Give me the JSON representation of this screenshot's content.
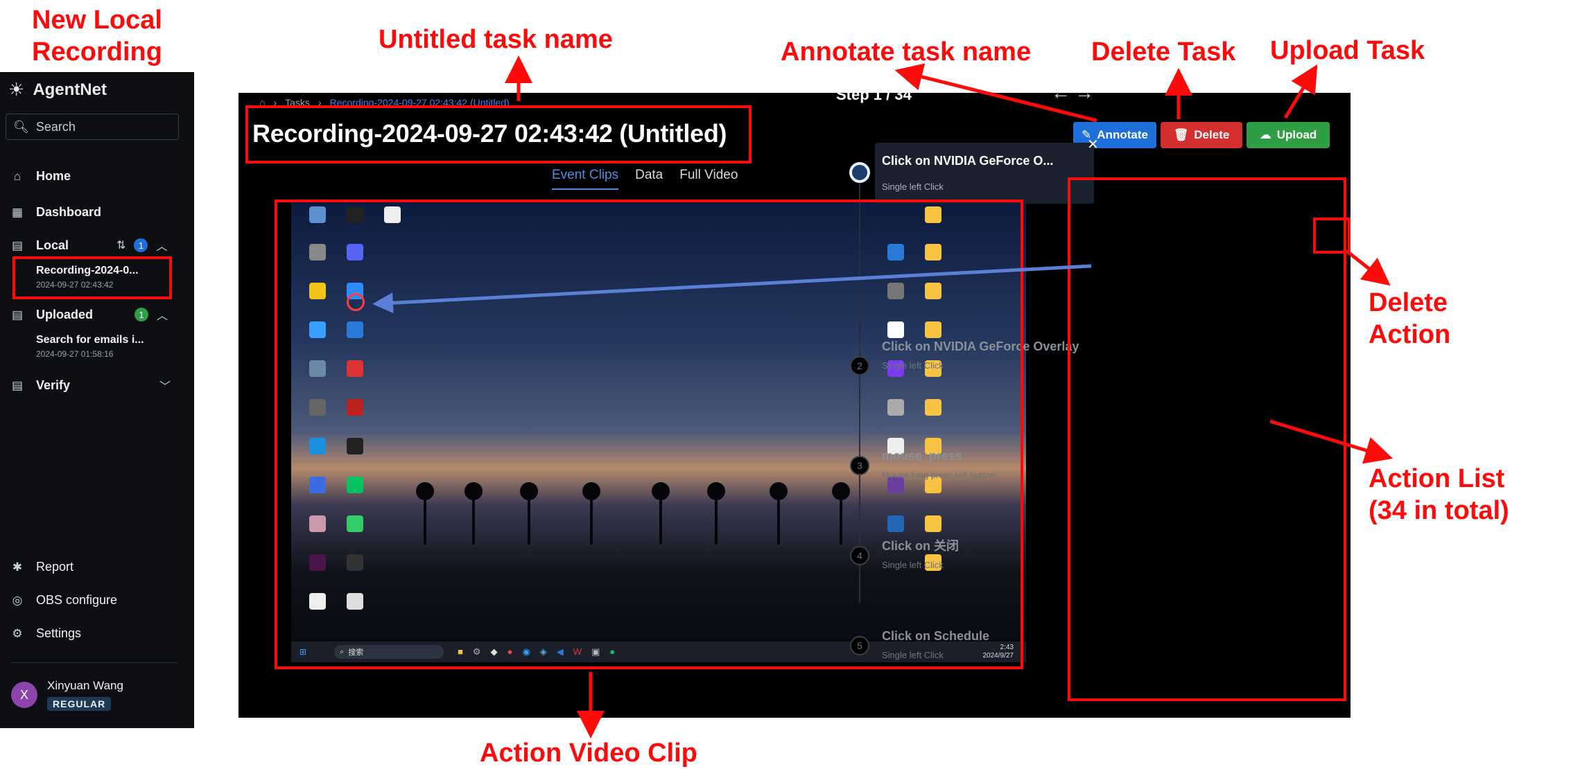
{
  "annotations": {
    "new_local_recording": "New Local\nRecording",
    "untitled_task_name": "Untitled task name",
    "annotate_task_name": "Annotate task name",
    "delete_task": "Delete Task",
    "upload_task": "Upload Task",
    "delete_action": "Delete\nAction",
    "action_list": "Action List\n(34 in total)",
    "action_video_clip": "Action Video Clip"
  },
  "sidebar": {
    "brand": "AgentNet",
    "search_placeholder": "Search",
    "home": "Home",
    "dashboard": "Dashboard",
    "local": "Local",
    "local_badge": "1",
    "local_recording_title": "Recording-2024-0...",
    "local_recording_date": "2024-09-27 02:43:42",
    "uploaded": "Uploaded",
    "uploaded_badge": "1",
    "uploaded_task_title": "Search for emails i...",
    "uploaded_task_date": "2024-09-27 01:58:16",
    "verify": "Verify",
    "report": "Report",
    "obs_configure": "OBS configure",
    "settings": "Settings",
    "user_initial": "X",
    "user_name": "Xinyuan Wang",
    "user_role": "REGULAR"
  },
  "main": {
    "breadcrumb_tasks": "Tasks",
    "breadcrumb_current": "Recording-2024-09-27 02:43:42 (Untitled)",
    "title": "Recording-2024-09-27 02:43:42 (Untitled)",
    "annotate_button": "Annotate",
    "delete_button": "Delete",
    "upload_button": "Upload",
    "tabs": [
      "Event Clips",
      "Data",
      "Full Video"
    ],
    "active_tab": "Event Clips"
  },
  "video": {
    "taskbar_search": "搜索",
    "taskbar_time": "2:43",
    "taskbar_date": "2024/9/27"
  },
  "steps": {
    "header": "Step 1 / 34",
    "items": [
      {
        "num": "1",
        "title": "Click on NVIDIA GeForce O...",
        "subtitle": "Single left Click"
      },
      {
        "num": "2",
        "title": "Click on NVIDIA GeForce Overlay",
        "subtitle": "Single left Click"
      },
      {
        "num": "3",
        "title": "mouse_press",
        "subtitle": "Mouse long press left button"
      },
      {
        "num": "4",
        "title": "Click on 关闭",
        "subtitle": "Single left Click"
      },
      {
        "num": "5",
        "title": "Click on Schedule",
        "subtitle": "Single left Click"
      }
    ]
  },
  "colors": {
    "annotation": "#ff0a0a",
    "annotate_btn": "#1e6fd9",
    "delete_btn": "#d32f2f",
    "upload_btn": "#2f9e44",
    "active_tab": "#4a90e2",
    "link_line": "#5b7fd6"
  },
  "icons": {
    "brand": "sun-icon",
    "search": "search-icon",
    "home": "home-icon",
    "dashboard": "dashboard-icon",
    "local": "clipboard-icon",
    "report": "bug-icon",
    "obs": "obs-icon",
    "settings": "gear-icon",
    "annotate": "pencil-icon",
    "delete": "trash-icon",
    "upload": "cloud-upload-icon",
    "close": "close-icon"
  }
}
